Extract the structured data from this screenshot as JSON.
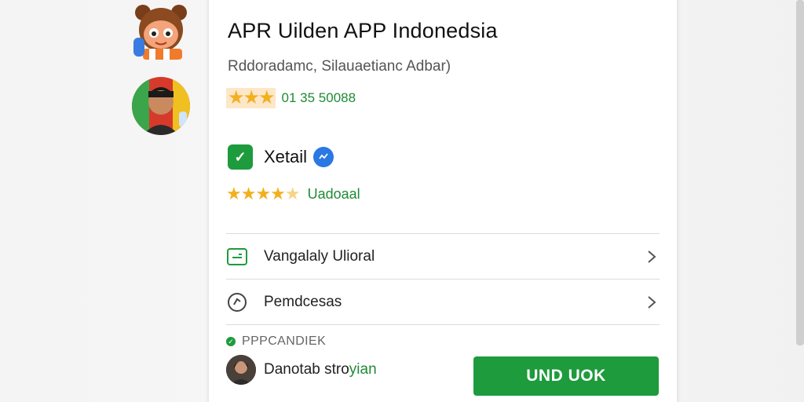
{
  "app": {
    "title": "APR Uilden APP Indonedsia",
    "subtitle": "Rddoradamc, Silauaetianc Adbar)",
    "rating_count": "01 35 50088"
  },
  "verified": {
    "label": "Xetail"
  },
  "rating_secondary": {
    "label": "Uadoaal"
  },
  "menu": {
    "items": [
      {
        "label": "Vangalaly Ulioral",
        "icon": "card-icon"
      },
      {
        "label": "Pemdcesas",
        "icon": "refresh-icon"
      }
    ]
  },
  "section": {
    "label": "PPPCANDIEK"
  },
  "author": {
    "name_a": "Danotab stro",
    "name_b": "yian"
  },
  "cta": {
    "label": "UND UOK"
  },
  "colors": {
    "accent_green": "#1e9b3c",
    "star": "#f2b01e",
    "blue_badge": "#2a78e4"
  }
}
